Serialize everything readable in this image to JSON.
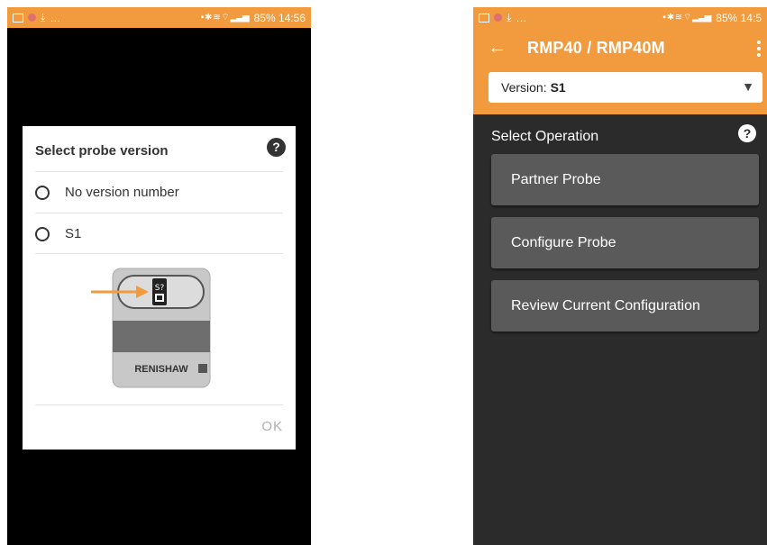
{
  "left_phone": {
    "status": {
      "right": "85% 14:56"
    },
    "dialog": {
      "title": "Select probe version",
      "help_glyph": "?",
      "options": [
        {
          "label": "No version number",
          "selected": false
        },
        {
          "label": "S1",
          "selected": false
        }
      ],
      "illustration": {
        "tag": "S?",
        "brand": "RENISHAW"
      },
      "ok_label": "OK"
    }
  },
  "right_phone": {
    "status": {
      "right": "85% 14:5"
    },
    "title": "RMP40 / RMP40M",
    "version_label": "Version:",
    "version_value": "S1",
    "section_title": "Select Operation",
    "help_glyph": "?",
    "operations": [
      {
        "label": "Partner Probe"
      },
      {
        "label": "Configure Probe"
      },
      {
        "label": "Review Current Configuration"
      }
    ]
  },
  "colors": {
    "accent": "#f19a3e",
    "dark_bg": "#2b2b2b",
    "button_bg": "#5a5a5a"
  },
  "icons": [
    "back-arrow-icon",
    "overflow-menu-icon",
    "help-icon",
    "dropdown-arrow-icon",
    "radio-icon"
  ]
}
